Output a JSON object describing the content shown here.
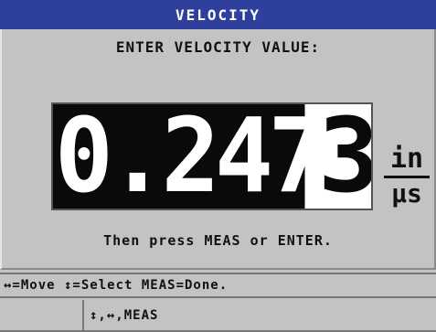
{
  "title": "VELOCITY",
  "prompt": "ENTER VELOCITY VALUE:",
  "value": {
    "entered": "0.247",
    "cursor_digit": "3"
  },
  "units": {
    "numerator": "in",
    "denominator": "µs"
  },
  "instruction": "Then press MEAS or ENTER.",
  "status_bar": "↔=Move ↕=Select MEAS=Done.",
  "key_bar": {
    "keys": "↕,↔,MEAS"
  },
  "colors": {
    "title_bar": "#2e3f9c",
    "background": "#c3c3c3",
    "value_fill": "#0a0a0a"
  }
}
